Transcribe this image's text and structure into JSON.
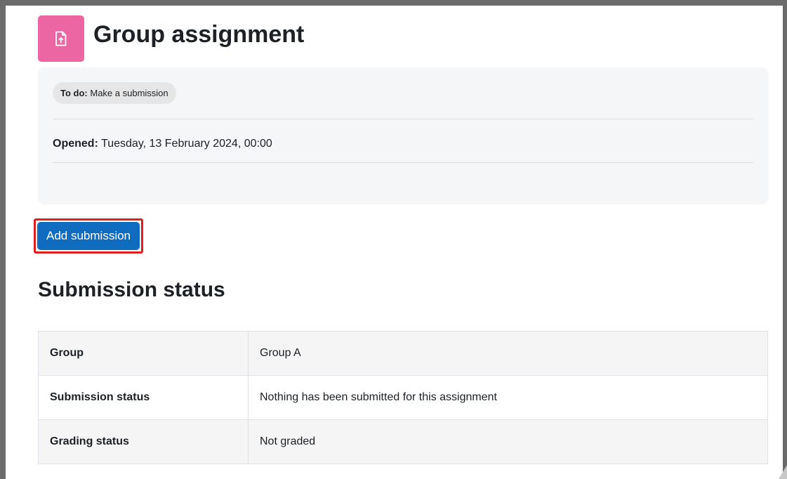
{
  "header": {
    "title": "Group assignment",
    "icon": "assignment-upload-icon",
    "icon_color": "#eb66a2"
  },
  "activity": {
    "todo_label": "To do:",
    "todo_value": "Make a submission",
    "opened_label": "Opened:",
    "opened_value": "Tuesday, 13 February 2024, 00:00"
  },
  "actions": {
    "add_submission_label": "Add submission",
    "button_color": "#0f6cbf",
    "highlight_color": "#e02020"
  },
  "submission_status": {
    "title": "Submission status",
    "rows": [
      {
        "label": "Group",
        "value": "Group A"
      },
      {
        "label": "Submission status",
        "value": "Nothing has been submitted for this assignment"
      },
      {
        "label": "Grading status",
        "value": "Not graded"
      }
    ]
  }
}
